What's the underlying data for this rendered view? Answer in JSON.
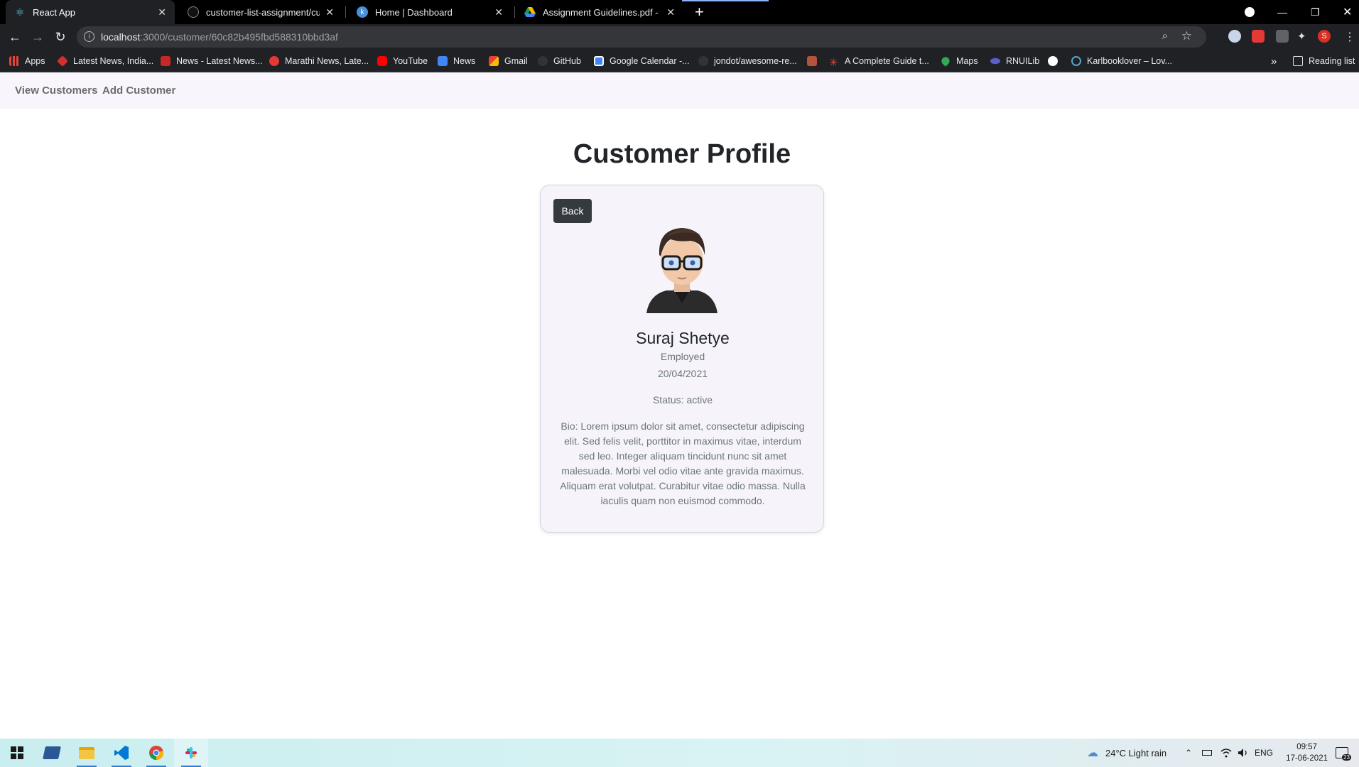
{
  "browser": {
    "tabs": [
      {
        "title": "React App",
        "active": true
      },
      {
        "title": "customer-list-assignment/custon",
        "active": false
      },
      {
        "title": "Home | Dashboard",
        "active": false
      },
      {
        "title": "Assignment Guidelines.pdf - Goo",
        "active": false
      }
    ],
    "url_host": "localhost",
    "url_rest": ":3000/customer/60c82b495fbd588310bbd3af",
    "bookmarks": [
      {
        "label": "Apps",
        "icon": "apps-grid-icon",
        "color": "#ea4335"
      },
      {
        "label": "Latest News, India...",
        "icon": "news-icon",
        "color": "#d32f2f"
      },
      {
        "label": "News - Latest News...",
        "icon": "toi-icon",
        "color": "#c62828"
      },
      {
        "label": "Marathi News, Late...",
        "icon": "news-icon",
        "color": "#e53935"
      },
      {
        "label": "YouTube",
        "icon": "youtube-icon",
        "color": "#ff0000"
      },
      {
        "label": "News",
        "icon": "google-news-icon",
        "color": "#4285f4"
      },
      {
        "label": "Gmail",
        "icon": "gmail-icon",
        "color": "#ea4335"
      },
      {
        "label": "GitHub",
        "icon": "github-icon",
        "color": "#333333"
      },
      {
        "label": "Google Calendar -...",
        "icon": "calendar-icon",
        "color": "#4285f4"
      },
      {
        "label": "jondot/awesome-re...",
        "icon": "github-icon",
        "color": "#333333"
      },
      {
        "label": "",
        "icon": "bookmark-icon",
        "color": "#b5533c"
      },
      {
        "label": "A Complete Guide t...",
        "icon": "star-icon",
        "color": "#e8453c"
      },
      {
        "label": "Maps",
        "icon": "maps-icon",
        "color": "#34a853"
      },
      {
        "label": "RNUILib",
        "icon": "rnuilib-icon",
        "color": "#5b5fc7"
      },
      {
        "label": "",
        "icon": "globe-icon",
        "color": "#ffffff"
      },
      {
        "label": "Karlbooklover – Lov...",
        "icon": "bookmark-icon",
        "color": "#5ba3d0"
      }
    ],
    "more_bookmarks": "»",
    "reading_list": "Reading list",
    "profile_initial": "S"
  },
  "app": {
    "nav": {
      "view_customers": "View Customers",
      "add_customer": "Add Customer"
    },
    "page_title": "Customer Profile",
    "back_label": "Back",
    "customer": {
      "name": "Suraj Shetye",
      "employment": "Employed",
      "date": "20/04/2021",
      "status": "Status: active",
      "bio": "Bio: Lorem ipsum dolor sit amet, consectetur adipiscing elit. Sed felis velit, porttitor in maximus vitae, interdum sed leo. Integer aliquam tincidunt nunc sit amet malesuada. Morbi vel odio vitae ante gravida maximus. Aliquam erat volutpat. Curabitur vitae odio massa. Nulla iaculis quam non euismod commodo."
    }
  },
  "taskbar": {
    "weather": "24°C  Light rain",
    "language": "ENG",
    "time": "09:57",
    "date": "17-06-2021",
    "notifications": "23"
  }
}
